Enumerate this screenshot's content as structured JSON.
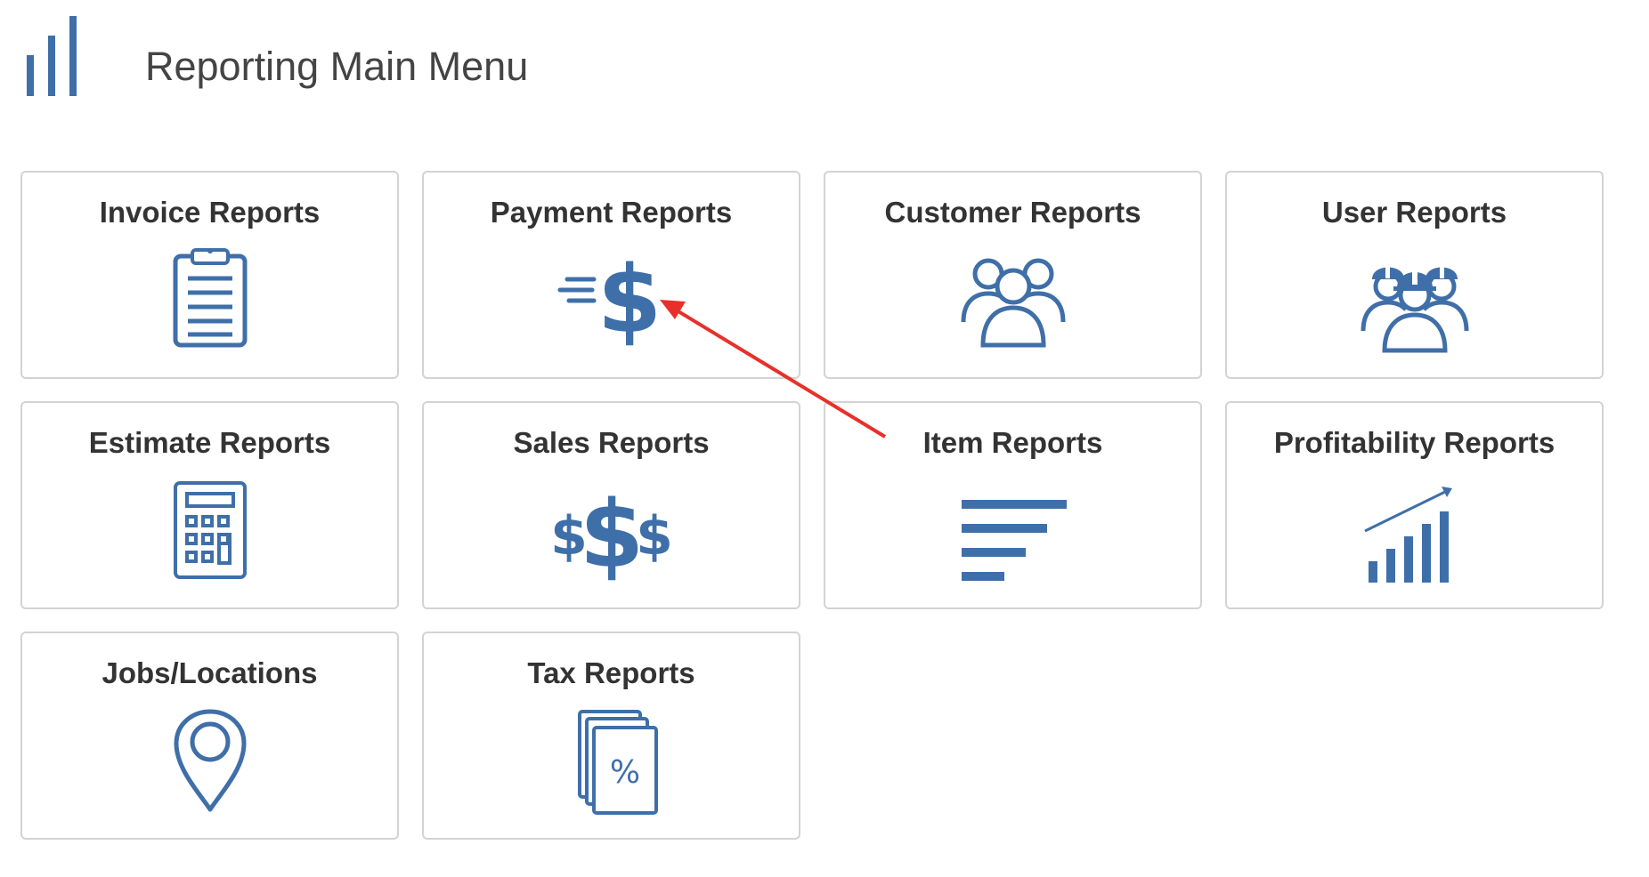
{
  "header": {
    "title": "Reporting Main Menu",
    "icon": "bar-chart-icon"
  },
  "tiles": [
    {
      "label": "Invoice Reports",
      "icon": "clipboard-icon"
    },
    {
      "label": "Payment Reports",
      "icon": "dollar-speed-icon"
    },
    {
      "label": "Customer Reports",
      "icon": "group-icon"
    },
    {
      "label": "User Reports",
      "icon": "workers-icon"
    },
    {
      "label": "Estimate Reports",
      "icon": "calculator-icon"
    },
    {
      "label": "Sales Reports",
      "icon": "dollars-icon"
    },
    {
      "label": "Item Reports",
      "icon": "list-bars-icon"
    },
    {
      "label": "Profitability Reports",
      "icon": "growth-chart-icon"
    },
    {
      "label": "Jobs/Locations",
      "icon": "map-pin-icon"
    },
    {
      "label": "Tax Reports",
      "icon": "tax-document-icon"
    }
  ],
  "colors": {
    "accent": "#3f6fa8",
    "annotation": "#e8302a",
    "tile_border": "#d3d3d3",
    "text": "#333333"
  }
}
